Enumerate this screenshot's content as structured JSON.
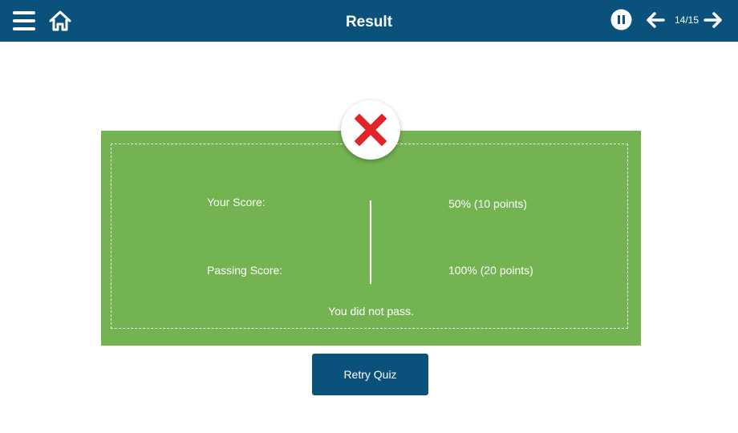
{
  "header": {
    "title": "Result",
    "page_counter": "14/15",
    "icons": {
      "menu": "menu-icon",
      "home": "home-icon",
      "pause": "pause-icon",
      "previous": "arrow-left-icon",
      "next": "arrow-right-icon"
    }
  },
  "result": {
    "status_icon": "fail-x-icon",
    "your_score_label": "Your Score:",
    "your_score_value": "50% (10 points)",
    "passing_score_label": "Passing Score:",
    "passing_score_value": "100% (20 points)",
    "message": "You did not pass."
  },
  "actions": {
    "retry_label": "Retry Quiz"
  },
  "colors": {
    "header_bg": "#0a527b",
    "panel_bg": "#73b352",
    "fail_icon": "#e3232a",
    "button_bg": "#0a527b"
  }
}
